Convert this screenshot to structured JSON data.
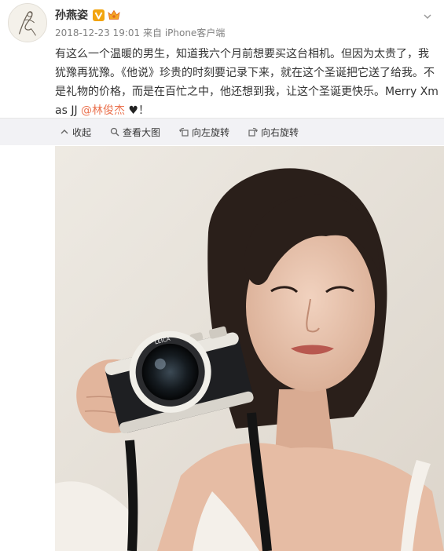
{
  "post": {
    "username": "孙燕姿",
    "timestamp": "2018-12-23 19:01",
    "source_prefix": "来自",
    "source": "iPhone客户端",
    "text_main": "有这么一个温暖的男生，知道我六个月前想要买这台相机。但因为太贵了，我犹豫再犹豫。《他说》珍贵的时刻要记录下来，就在这个圣诞把它送了给我。不是礼物的价格，而是在百忙之中，他还想到我，让这个圣诞更快乐。Merry Xmas JJ ",
    "mention": "@林俊杰",
    "heart": "♥",
    "text_end": "！"
  },
  "toolbar": {
    "collapse_label": "收起",
    "view_large_label": "查看大图",
    "rotate_left_label": "向左旋转",
    "rotate_right_label": "向右旋转"
  },
  "colors": {
    "mention": "#eb7350",
    "toolbar_bg": "#f2f2f5",
    "meta": "#808080",
    "badge": "#f2a40f"
  },
  "icons": {
    "verified": "verified-v-icon",
    "vip": "vip-crown-icon",
    "dropdown": "chevron-down-icon",
    "collapse": "collapse-icon",
    "view_large": "magnifier-icon",
    "rotate_left": "rotate-left-icon",
    "rotate_right": "rotate-right-icon"
  },
  "camera": {
    "brand_ring": "LEICA"
  }
}
